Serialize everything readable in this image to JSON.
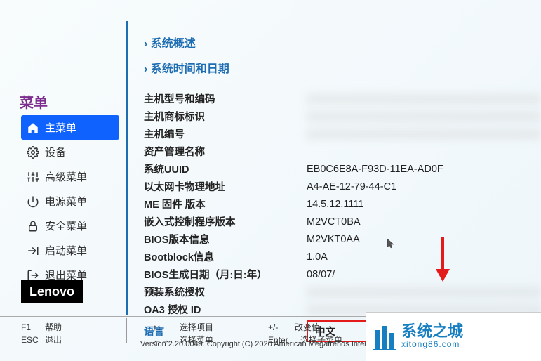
{
  "sidebar": {
    "title": "菜单",
    "items": [
      {
        "label": "主菜单",
        "icon": "home"
      },
      {
        "label": "设备",
        "icon": "gear"
      },
      {
        "label": "高级菜单",
        "icon": "sliders"
      },
      {
        "label": "电源菜单",
        "icon": "power"
      },
      {
        "label": "安全菜单",
        "icon": "lock"
      },
      {
        "label": "启动菜单",
        "icon": "export"
      },
      {
        "label": "退出菜单",
        "icon": "exit"
      }
    ]
  },
  "sections": {
    "overview": "系统概述",
    "datetime": "系统时间和日期"
  },
  "info": [
    {
      "label": "主机型号和编码",
      "value": "",
      "blurred": true
    },
    {
      "label": "主机商标标识",
      "value": "",
      "blurred": true
    },
    {
      "label": "主机编号",
      "value": "",
      "blurred": true
    },
    {
      "label": "资产管理名称",
      "value": "",
      "blurred": false
    },
    {
      "label": "系统UUID",
      "value": "EB0C6E8A-F93D-11EA-AD0F",
      "blurred": false
    },
    {
      "label": "以太网卡物理地址",
      "value": "A4-AE-12-79-44-C1",
      "blurred": false
    },
    {
      "label": "ME 固件 版本",
      "value": "14.5.12.1111",
      "blurred": false
    },
    {
      "label": "嵌入式控制程序版本",
      "value": "M2VCT0BA",
      "blurred": false
    },
    {
      "label": "BIOS版本信息",
      "value": "M2VKT0AA",
      "blurred": false
    },
    {
      "label": "Bootblock信息",
      "value": "1.0A",
      "blurred": false
    },
    {
      "label": "BIOS生成日期（月:日:年）",
      "value": "08/07/",
      "blurred": false
    },
    {
      "label": "预装系统授权",
      "value": "",
      "blurred": true
    },
    {
      "label": "OA3 授权 ID",
      "value": "",
      "blurred": true
    }
  ],
  "language": {
    "label": "语言",
    "value": "中文"
  },
  "logo": "Lenovo",
  "footer": {
    "f1": {
      "key": "F1",
      "desc": "帮助"
    },
    "esc": {
      "key": "ESC",
      "desc": "退出"
    },
    "arrows1": {
      "key": "↑↓",
      "desc": "选择项目"
    },
    "arrows2": {
      "key": "←→",
      "desc": "选择菜单"
    },
    "pm": {
      "key": "+/-",
      "desc": "改变值"
    },
    "enter": {
      "key": "Enter",
      "desc": "选择子菜单"
    },
    "version": "Version 2.20.0049. Copyright (C) 2020 American Megatrends Intern"
  },
  "overlay": {
    "main": "系统之城",
    "sub": "xitong86.com"
  }
}
